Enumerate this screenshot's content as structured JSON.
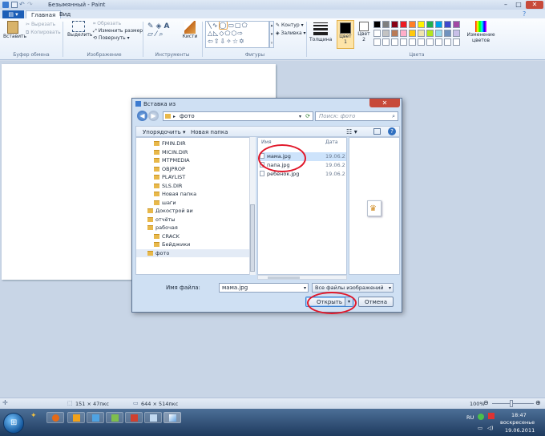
{
  "window": {
    "title": "Безымянный - Paint"
  },
  "ribbon": {
    "file_tab": "",
    "tabs": [
      "Главная",
      "Вид"
    ],
    "clipboard": {
      "paste": "Вставить",
      "cut": "Вырезать",
      "copy": "Копировать",
      "label": "Буфер обмена"
    },
    "image": {
      "select": "Выделить",
      "crop": "Обрезать",
      "resize": "Изменить размер",
      "rotate": "Повернуть",
      "label": "Изображение"
    },
    "tools": {
      "brushes": "Кисти",
      "label": "Инструменты"
    },
    "shapes": {
      "outline": "Контур",
      "fill": "Заливка",
      "label": "Фигуры"
    },
    "size": {
      "label": "Толщина"
    },
    "colors": {
      "color1": "Цвет 1",
      "color2": "Цвет 2",
      "edit": "Изменение цветов",
      "label": "Цвета",
      "palette_row1": [
        "#000000",
        "#7f7f7f",
        "#880015",
        "#ed1c24",
        "#ff7f27",
        "#fff200",
        "#22b14c",
        "#00a2e8",
        "#3f48cc",
        "#a349a4"
      ],
      "palette_row2": [
        "#ffffff",
        "#c3c3c3",
        "#b97a57",
        "#ffaec9",
        "#ffc90e",
        "#efe4b0",
        "#b5e61d",
        "#99d9ea",
        "#7092be",
        "#c8bfe7"
      ]
    }
  },
  "dialog": {
    "title": "Вставка из",
    "address": "фото",
    "search_placeholder": "Поиск: фото",
    "organize": "Упорядочить ▾",
    "new_folder": "Новая папка",
    "tree": [
      "FMIN.DIR",
      "MICIN.DIR",
      "MTPMEDIA",
      "OBJPROP",
      "PLAYLIST",
      "SLS.DIR",
      "Новая папка",
      "шаги",
      "Докострой ви",
      "отчёты",
      "рабочая",
      "CRACK",
      "Бейджики",
      "фото"
    ],
    "columns": {
      "name": "Имя",
      "date": "Дата"
    },
    "files": [
      {
        "name": "мама.jpg",
        "date": "19.06.2"
      },
      {
        "name": "папа.jpg",
        "date": "19.06.2"
      },
      {
        "name": "ребенок.jpg",
        "date": "19.06.2"
      }
    ],
    "filename_label": "Имя файла:",
    "filename_value": "мама.jpg",
    "filetype_value": "Все файлы изображений",
    "open": "Открыть",
    "cancel": "Отмена"
  },
  "status": {
    "selection": "151 × 47пкс",
    "canvas_size": "644 × 514пкс",
    "zoom": "100%"
  },
  "taskbar": {
    "lang": "RU",
    "time": "18:47",
    "day": "воскресенье",
    "date": "19.06.2011"
  }
}
